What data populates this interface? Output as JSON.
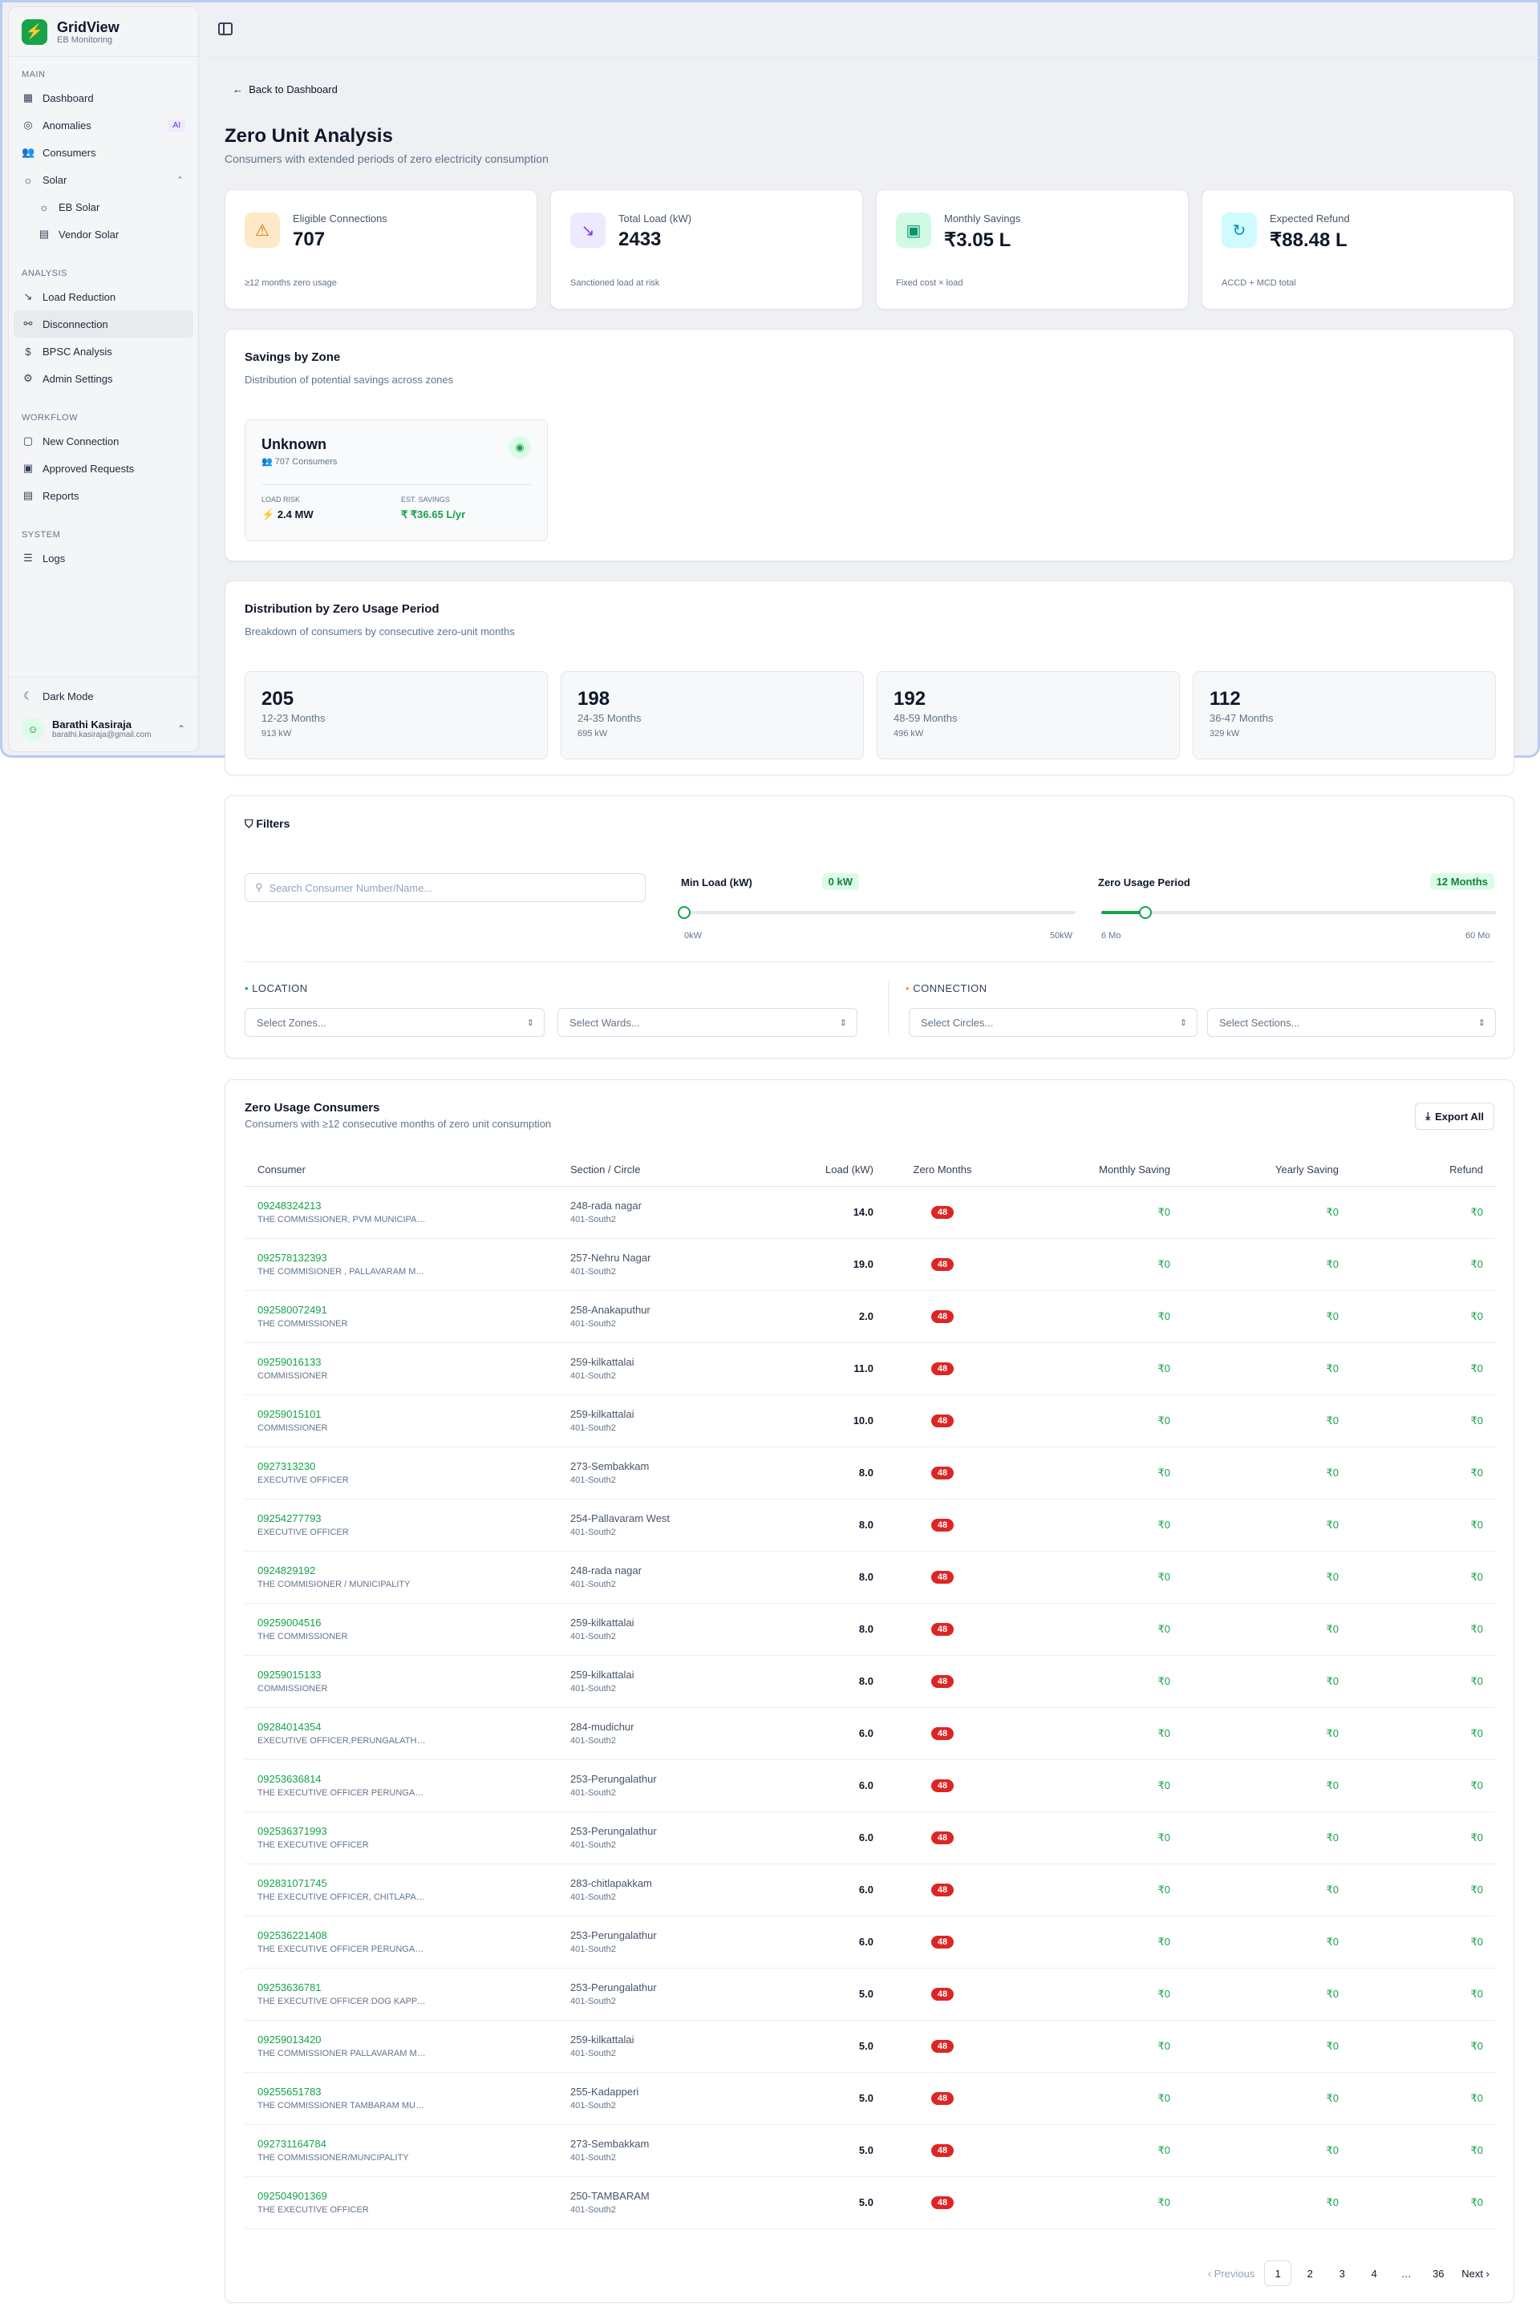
{
  "app": {
    "name": "GridView",
    "subtitle": "EB Monitoring"
  },
  "sidebar": {
    "sections": [
      {
        "label": "MAIN"
      },
      {
        "label": "ANALYSIS"
      },
      {
        "label": "WORKFLOW"
      },
      {
        "label": "SYSTEM"
      }
    ],
    "main": [
      "Dashboard",
      "Anomalies",
      "Consumers",
      "Solar",
      "EB Solar",
      "Vendor Solar"
    ],
    "anomalies_badge": "AI",
    "analysis": [
      "Load Reduction",
      "Disconnection",
      "BPSC Analysis",
      "Admin Settings"
    ],
    "workflow": [
      "New Connection",
      "Approved Requests",
      "Reports"
    ],
    "system": [
      "Logs"
    ],
    "dark_mode": "Dark Mode",
    "user": {
      "name": "Barathi Kasiraja",
      "email": "barathi.kasiraja@gmail.com"
    }
  },
  "page": {
    "back": "Back to Dashboard",
    "title": "Zero Unit Analysis",
    "subtitle": "Consumers with extended periods of zero electricity consumption"
  },
  "stats": [
    {
      "label": "Eligible Connections",
      "value": "707",
      "note": "≥12 months zero usage",
      "icon": "alert-triangle-icon"
    },
    {
      "label": "Total Load (kW)",
      "value": "2433",
      "note": "Sanctioned load at risk",
      "icon": "trend-down-icon"
    },
    {
      "label": "Monthly Savings",
      "value": "₹3.05 L",
      "note": "Fixed cost × load",
      "icon": "wallet-icon"
    },
    {
      "label": "Expected Refund",
      "value": "₹88.48 L",
      "note": "ACCD + MCD total",
      "icon": "refresh-icon"
    }
  ],
  "zones": {
    "title": "Savings by Zone",
    "subtitle": "Distribution of potential savings across zones",
    "items": [
      {
        "name": "Unknown",
        "consumers": "707 Consumers",
        "load_label": "LOAD RISK",
        "load": "2.4 MW",
        "savings_label": "EST. SAVINGS",
        "savings": "₹36.65 L/yr"
      }
    ]
  },
  "periods": {
    "title": "Distribution by Zero Usage Period",
    "subtitle": "Breakdown of consumers by consecutive zero-unit months",
    "items": [
      {
        "count": "205",
        "label": "12-23 Months",
        "kw": "913 kW"
      },
      {
        "count": "198",
        "label": "24-35 Months",
        "kw": "695 kW"
      },
      {
        "count": "192",
        "label": "48-59 Months",
        "kw": "496 kW"
      },
      {
        "count": "112",
        "label": "36-47 Months",
        "kw": "329 kW"
      }
    ]
  },
  "filters": {
    "title": "Filters",
    "search_placeholder": "Search Consumer Number/Name...",
    "min_load": {
      "label": "Min Load (kW)",
      "value": "0 kW",
      "min": "0kW",
      "max": "50kW",
      "fraction": 0
    },
    "zero_period": {
      "label": "Zero Usage Period",
      "value": "12 Months",
      "min": "6 Mo",
      "max": "60 Mo",
      "fraction": 0.111
    },
    "location": "LOCATION",
    "connection": "CONNECTION",
    "selects": [
      "Select Zones...",
      "Select Wards...",
      "Select Circles...",
      "Select Sections..."
    ]
  },
  "table": {
    "title": "Zero Usage Consumers",
    "subtitle": "Consumers with ≥12 consecutive months of zero unit consumption",
    "export": "Export All",
    "columns": [
      "Consumer",
      "Section / Circle",
      "Load (kW)",
      "Zero Months",
      "Monthly Saving",
      "Yearly Saving",
      "Refund"
    ],
    "rows": [
      {
        "num": "09248324213",
        "name": "THE COMMISSIONER, PVM MUNICIPALITY",
        "section": "248-rada nagar",
        "circle": "401-South2",
        "load": "14.0",
        "zero": "48",
        "monthly": "₹0",
        "yearly": "₹0",
        "refund": "₹0"
      },
      {
        "num": "092578132393",
        "name": "THE COMMISIONER , PALLAVARAM MUNICIPALITY",
        "section": "257-Nehru Nagar",
        "circle": "401-South2",
        "load": "19.0",
        "zero": "48",
        "monthly": "₹0",
        "yearly": "₹0",
        "refund": "₹0"
      },
      {
        "num": "092580072491",
        "name": "THE COMMISSIONER",
        "section": "258-Anakaputhur",
        "circle": "401-South2",
        "load": "2.0",
        "zero": "48",
        "monthly": "₹0",
        "yearly": "₹0",
        "refund": "₹0"
      },
      {
        "num": "09259016133",
        "name": "COMMISSIONER",
        "section": "259-kilkattalai",
        "circle": "401-South2",
        "load": "11.0",
        "zero": "48",
        "monthly": "₹0",
        "yearly": "₹0",
        "refund": "₹0"
      },
      {
        "num": "09259015101",
        "name": "COMMISSIONER",
        "section": "259-kilkattalai",
        "circle": "401-South2",
        "load": "10.0",
        "zero": "48",
        "monthly": "₹0",
        "yearly": "₹0",
        "refund": "₹0"
      },
      {
        "num": "0927313230",
        "name": "EXECUTIVE OFFICER",
        "section": "273-Sembakkam",
        "circle": "401-South2",
        "load": "8.0",
        "zero": "48",
        "monthly": "₹0",
        "yearly": "₹0",
        "refund": "₹0"
      },
      {
        "num": "09254277793",
        "name": "EXECUTIVE OFFICER",
        "section": "254-Pallavaram West",
        "circle": "401-South2",
        "load": "8.0",
        "zero": "48",
        "monthly": "₹0",
        "yearly": "₹0",
        "refund": "₹0"
      },
      {
        "num": "0924829192",
        "name": "THE COMMISIONER / MUNICIPALITY",
        "section": "248-rada nagar",
        "circle": "401-South2",
        "load": "8.0",
        "zero": "48",
        "monthly": "₹0",
        "yearly": "₹0",
        "refund": "₹0"
      },
      {
        "num": "09259004516",
        "name": "THE COMMISSIONER",
        "section": "259-kilkattalai",
        "circle": "401-South2",
        "load": "8.0",
        "zero": "48",
        "monthly": "₹0",
        "yearly": "₹0",
        "refund": "₹0"
      },
      {
        "num": "09259015133",
        "name": "COMMISSIONER",
        "section": "259-kilkattalai",
        "circle": "401-South2",
        "load": "8.0",
        "zero": "48",
        "monthly": "₹0",
        "yearly": "₹0",
        "refund": "₹0"
      },
      {
        "num": "09284014354",
        "name": "EXECUTIVE OFFICER,PERUNGALATHUR",
        "section": "284-mudichur",
        "circle": "401-South2",
        "load": "6.0",
        "zero": "48",
        "monthly": "₹0",
        "yearly": "₹0",
        "refund": "₹0"
      },
      {
        "num": "09253636814",
        "name": "THE EXECUTIVE OFFICER PERUNGALATHUR",
        "section": "253-Perungalathur",
        "circle": "401-South2",
        "load": "6.0",
        "zero": "48",
        "monthly": "₹0",
        "yearly": "₹0",
        "refund": "₹0"
      },
      {
        "num": "092536371993",
        "name": "THE EXECUTIVE OFFICER",
        "section": "253-Perungalathur",
        "circle": "401-South2",
        "load": "6.0",
        "zero": "48",
        "monthly": "₹0",
        "yearly": "₹0",
        "refund": "₹0"
      },
      {
        "num": "092831071745",
        "name": "THE EXECUTIVE OFFICER, CHITLAPAKKAM",
        "section": "283-chitlapakkam",
        "circle": "401-South2",
        "load": "6.0",
        "zero": "48",
        "monthly": "₹0",
        "yearly": "₹0",
        "refund": "₹0"
      },
      {
        "num": "092536221408",
        "name": "THE EXECUTIVE OFFICER PERUNGALATHUR",
        "section": "253-Perungalathur",
        "circle": "401-South2",
        "load": "6.0",
        "zero": "48",
        "monthly": "₹0",
        "yearly": "₹0",
        "refund": "₹0"
      },
      {
        "num": "09253636781",
        "name": "THE EXECUTIVE OFFICER DOG KAPPAGAM",
        "section": "253-Perungalathur",
        "circle": "401-South2",
        "load": "5.0",
        "zero": "48",
        "monthly": "₹0",
        "yearly": "₹0",
        "refund": "₹0"
      },
      {
        "num": "09259013420",
        "name": "THE COMMISSIONER PALLAVARAM MUNICIPALITY",
        "section": "259-kilkattalai",
        "circle": "401-South2",
        "load": "5.0",
        "zero": "48",
        "monthly": "₹0",
        "yearly": "₹0",
        "refund": "₹0"
      },
      {
        "num": "09255651783",
        "name": "THE COMMISSIONER TAMBARAM MUNICIPALITY",
        "section": "255-Kadapperi",
        "circle": "401-South2",
        "load": "5.0",
        "zero": "48",
        "monthly": "₹0",
        "yearly": "₹0",
        "refund": "₹0"
      },
      {
        "num": "092731164784",
        "name": "THE COMMISSIONER/MUNCIPALITY",
        "section": "273-Sembakkam",
        "circle": "401-South2",
        "load": "5.0",
        "zero": "48",
        "monthly": "₹0",
        "yearly": "₹0",
        "refund": "₹0"
      },
      {
        "num": "092504901369",
        "name": "THE EXECUTIVE OFFICER",
        "section": "250-TAMBARAM",
        "circle": "401-South2",
        "load": "5.0",
        "zero": "48",
        "monthly": "₹0",
        "yearly": "₹0",
        "refund": "₹0"
      }
    ]
  },
  "pagination": {
    "prev": "Previous",
    "pages": [
      "1",
      "2",
      "3",
      "4"
    ],
    "ellipsis": "…",
    "last": "36",
    "next": "Next"
  },
  "colors": {
    "accent": "#16a34a",
    "badge": "#dc2626"
  }
}
